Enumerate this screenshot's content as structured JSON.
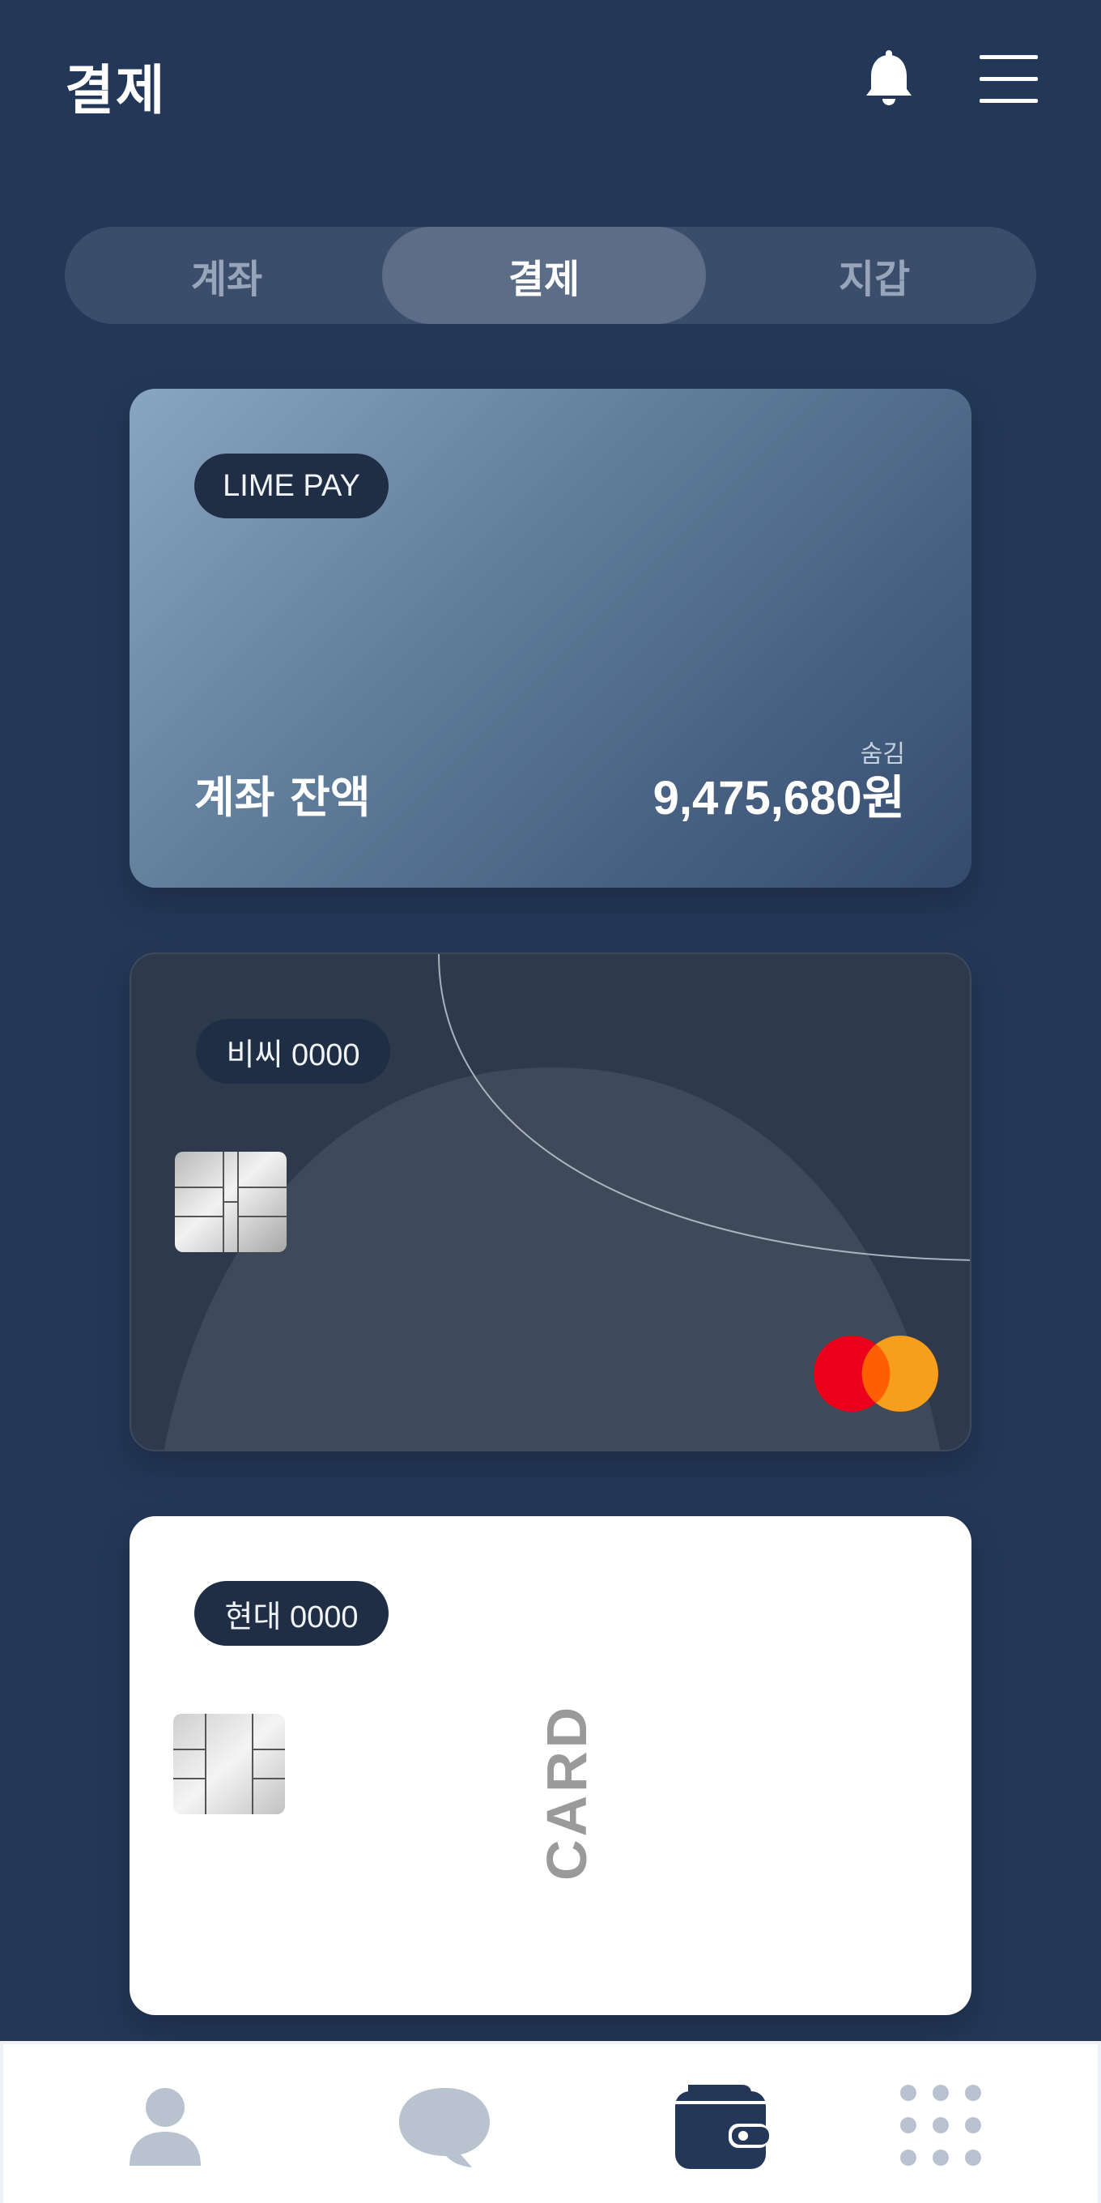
{
  "header": {
    "title": "결제",
    "icons": {
      "notification": "bell-icon",
      "menu": "hamburger-menu-icon"
    }
  },
  "tabs": [
    {
      "label": "계좌",
      "active": false
    },
    {
      "label": "결제",
      "active": true
    },
    {
      "label": "지갑",
      "active": false
    }
  ],
  "cards": {
    "account": {
      "badge": "LIME PAY",
      "balance_label": "계좌 잔액",
      "hide_label": "숨김",
      "balance_value": "9,475,680원"
    },
    "bc": {
      "badge": "비씨 0000",
      "network": "mastercard-logo"
    },
    "hyundai": {
      "badge": "현대 0000",
      "vertical_text": "CARD"
    }
  },
  "bottom_nav": [
    {
      "icon": "user-icon",
      "active": false
    },
    {
      "icon": "chat-bubble-icon",
      "active": false
    },
    {
      "icon": "wallet-icon",
      "active": true
    },
    {
      "icon": "grid-dots-icon",
      "active": false
    }
  ],
  "colors": {
    "background": "#233858",
    "segment_bg": "#3a4e6c",
    "segment_active": "#5c6d87",
    "nav_active": "#233858",
    "nav_inactive": "#b9c2cf",
    "mastercard_red": "#eb001b",
    "mastercard_orange": "#f79e1b"
  }
}
